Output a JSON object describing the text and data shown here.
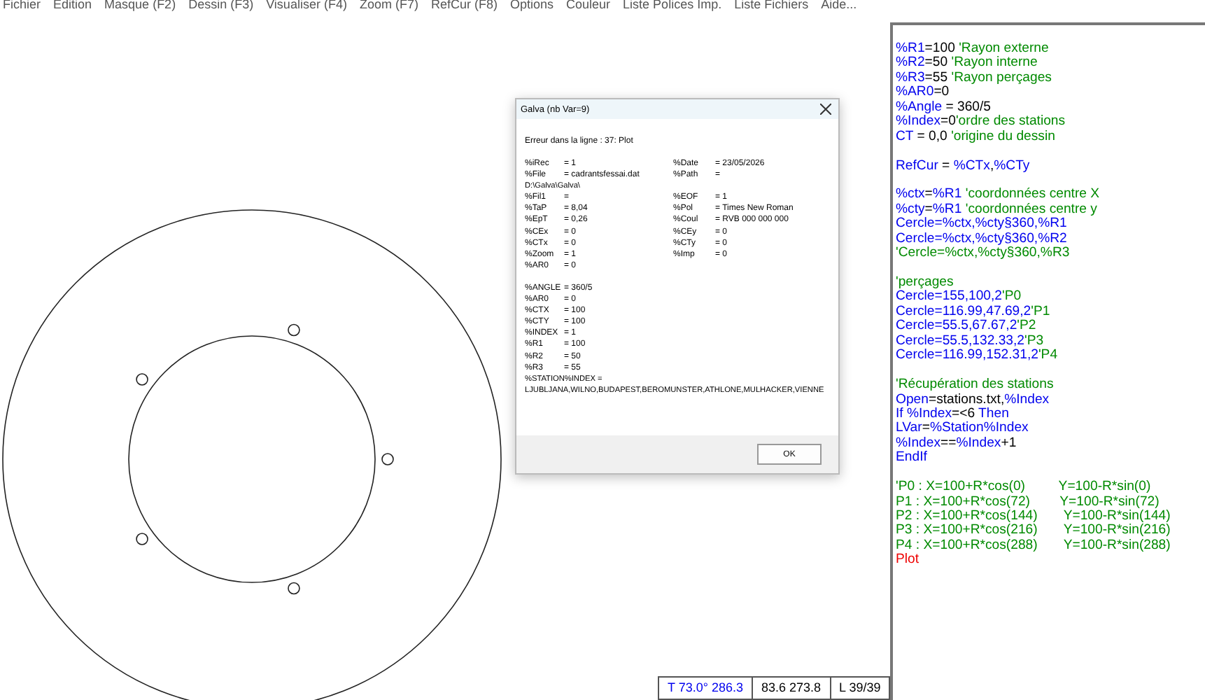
{
  "menu": [
    "Fichier",
    "Edition",
    "Masque (F2)",
    "Dessin (F3)",
    "Visualiser (F4)",
    "Zoom (F7)",
    "RefCur (F8)",
    "Options",
    "Couleur",
    "Liste Polices Imp.",
    "Liste Fichiers",
    "Aide..."
  ],
  "dialog": {
    "title": "Galva    (nb Var=9)",
    "error": "Erreur dans la ligne :  37: Plot",
    "rows": [
      {
        "left": "%iRec",
        "left_value": "= 1",
        "right": "%Date",
        "right_value": "= 23/05/2026"
      },
      {
        "left": "%File",
        "left_value": "= cadrantsfessai.dat",
        "right": "%Path",
        "right_value": "="
      },
      {
        "wide": "D:\\Galva\\Galva\\"
      },
      {
        "left": "%Fil1",
        "left_value": "=",
        "right": "%EOF",
        "right_value": "= 1"
      },
      {
        "left": "%TaP",
        "left_value": "= 8,04",
        "right": "%Pol",
        "right_value": "= Times New Roman"
      },
      {
        "left": "%EpT",
        "left_value": "= 0,26",
        "right": "%Coul",
        "right_value": "= RVB 000 000 000"
      },
      {
        "left": "%CEx",
        "left_value": "= 0",
        "right": "%CEy",
        "right_value": "= 0"
      },
      {
        "left": "%CTx",
        "left_value": "= 0",
        "right": "%CTy",
        "right_value": "= 0"
      },
      {
        "left": "%Zoom",
        "left_value": "=  1",
        "right": "%Imp",
        "right_value": "= 0"
      },
      {
        "left": "%AR0",
        "left_value": "= 0"
      }
    ],
    "vars": [
      {
        "left": "%ANGLE",
        "left_value": "= 360/5"
      },
      {
        "left": "%AR0",
        "left_value": "= 0"
      },
      {
        "left": "%CTX",
        "left_value": "= 100"
      },
      {
        "left": "%CTY",
        "left_value": "= 100"
      },
      {
        "left": "%INDEX",
        "left_value": "= 1"
      },
      {
        "left": "%R1",
        "left_value": "= 100"
      },
      {
        "left": "%R2",
        "left_value": "= 50"
      },
      {
        "left": "%R3",
        "left_value": "= 55"
      },
      {
        "wide": "%STATION%INDEX ="
      },
      {
        "wide": "LJUBLJANA,WILNO,BUDAPEST,BEROMUNSTER,ATHLONE,MULHACKER,VIENNE"
      }
    ],
    "ok": "OK"
  },
  "editor": {
    "lines": [
      {
        "segments": [
          {
            "kind": "kw",
            "text": "%R1"
          },
          {
            "kind": "plain",
            "text": "=100 "
          },
          {
            "kind": "comment",
            "text": "'Rayon externe"
          }
        ]
      },
      {
        "segments": [
          {
            "kind": "kw",
            "text": "%R2"
          },
          {
            "kind": "plain",
            "text": "=50 "
          },
          {
            "kind": "comment",
            "text": "'Rayon interne"
          }
        ]
      },
      {
        "segments": [
          {
            "kind": "kw",
            "text": "%R3"
          },
          {
            "kind": "plain",
            "text": "=55 "
          },
          {
            "kind": "comment",
            "text": "'Rayon perçages"
          }
        ]
      },
      {
        "segments": [
          {
            "kind": "kw",
            "text": "%AR0"
          },
          {
            "kind": "plain",
            "text": "=0"
          }
        ]
      },
      {
        "segments": [
          {
            "kind": "kw",
            "text": "%Angle"
          },
          {
            "kind": "plain",
            "text": " = 360/5"
          }
        ]
      },
      {
        "segments": [
          {
            "kind": "kw",
            "text": "%Index"
          },
          {
            "kind": "plain",
            "text": "=0"
          },
          {
            "kind": "comment",
            "text": "'ordre des stations"
          }
        ]
      },
      {
        "segments": [
          {
            "kind": "kw",
            "text": "CT"
          },
          {
            "kind": "plain",
            "text": " = 0,0 "
          },
          {
            "kind": "comment",
            "text": "'origine du dessin"
          }
        ]
      },
      {
        "kind": "blank"
      },
      {
        "segments": [
          {
            "kind": "kw",
            "text": "RefCur"
          },
          {
            "kind": "plain",
            "text": " = "
          },
          {
            "kind": "kw",
            "text": "%CTx"
          },
          {
            "kind": "plain",
            "text": ","
          },
          {
            "kind": "kw",
            "text": "%CTy"
          }
        ]
      },
      {
        "kind": "blank"
      },
      {
        "segments": [
          {
            "kind": "kw",
            "text": "%ctx"
          },
          {
            "kind": "plain",
            "text": "="
          },
          {
            "kind": "kw",
            "text": "%R1"
          },
          {
            "kind": "comment",
            "text": " 'coordonnées centre X"
          }
        ]
      },
      {
        "segments": [
          {
            "kind": "kw",
            "text": "%cty"
          },
          {
            "kind": "plain",
            "text": "="
          },
          {
            "kind": "kw",
            "text": "%R1"
          },
          {
            "kind": "comment",
            "text": " 'coordonnées centre y"
          }
        ]
      },
      {
        "segments": [
          {
            "kind": "kw",
            "text": "Cercle=%ctx,%cty§360,%R1"
          }
        ]
      },
      {
        "segments": [
          {
            "kind": "kw",
            "text": "Cercle=%ctx,%cty§360,%R2"
          }
        ]
      },
      {
        "segments": [
          {
            "kind": "comment",
            "text": "'Cercle=%ctx,%cty§360,%R3"
          }
        ]
      },
      {
        "kind": "blank"
      },
      {
        "segments": [
          {
            "kind": "comment",
            "text": "'perçages"
          }
        ]
      },
      {
        "segments": [
          {
            "kind": "kw",
            "text": "Cercle=155,100,2"
          },
          {
            "kind": "comment",
            "text": "'P0"
          }
        ]
      },
      {
        "segments": [
          {
            "kind": "kw",
            "text": "Cercle=116.99,47.69,2"
          },
          {
            "kind": "comment",
            "text": "'P1"
          }
        ]
      },
      {
        "segments": [
          {
            "kind": "kw",
            "text": "Cercle=55.5,67.67,2"
          },
          {
            "kind": "comment",
            "text": "'P2"
          }
        ]
      },
      {
        "segments": [
          {
            "kind": "kw",
            "text": "Cercle=55.5,132.33,2"
          },
          {
            "kind": "comment",
            "text": "'P3"
          }
        ]
      },
      {
        "segments": [
          {
            "kind": "kw",
            "text": "Cercle=116.99,152.31,2"
          },
          {
            "kind": "comment",
            "text": "'P4"
          }
        ]
      },
      {
        "kind": "blank"
      },
      {
        "segments": [
          {
            "kind": "comment",
            "text": "'Récupération des stations"
          }
        ]
      },
      {
        "segments": [
          {
            "kind": "kw",
            "text": "Open"
          },
          {
            "kind": "plain",
            "text": "=stations.txt,"
          },
          {
            "kind": "kw",
            "text": "%Index"
          }
        ]
      },
      {
        "segments": [
          {
            "kind": "kw",
            "text": "If %Index"
          },
          {
            "kind": "plain",
            "text": "=<6 "
          },
          {
            "kind": "kw",
            "text": "Then"
          }
        ]
      },
      {
        "segments": [
          {
            "kind": "kw",
            "text": "LVar"
          },
          {
            "kind": "plain",
            "text": "="
          },
          {
            "kind": "kw",
            "text": "%Station%Index"
          }
        ]
      },
      {
        "segments": [
          {
            "kind": "kw",
            "text": "%Index"
          },
          {
            "kind": "plain",
            "text": "=="
          },
          {
            "kind": "kw",
            "text": "%Index"
          },
          {
            "kind": "plain",
            "text": "+1"
          }
        ]
      },
      {
        "segments": [
          {
            "kind": "kw",
            "text": "EndIf"
          }
        ]
      },
      {
        "kind": "blank"
      },
      {
        "segments": [
          {
            "kind": "comment",
            "text": "'P0 : X=100+R*cos(0)         Y=100-R*sin(0)"
          }
        ]
      },
      {
        "segments": [
          {
            "kind": "comment",
            "text": "P1 : X=100+R*cos(72)        Y=100-R*sin(72)"
          }
        ]
      },
      {
        "segments": [
          {
            "kind": "comment",
            "text": "P2 : X=100+R*cos(144)       Y=100-R*sin(144)"
          }
        ]
      },
      {
        "segments": [
          {
            "kind": "comment",
            "text": "P3 : X=100+R*cos(216)       Y=100-R*sin(216)"
          }
        ]
      },
      {
        "segments": [
          {
            "kind": "comment",
            "text": "P4 : X=100+R*cos(288)       Y=100-R*sin(288)"
          }
        ]
      },
      {
        "segments": [
          {
            "kind": "error",
            "text": "Plot"
          }
        ]
      }
    ]
  },
  "status_bar": [
    {
      "kind": "accent",
      "text": "T 73.0°  286.3"
    },
    {
      "kind": "plain",
      "text": "83.6  273.8"
    },
    {
      "kind": "plain",
      "text": "L 39/39"
    }
  ]
}
